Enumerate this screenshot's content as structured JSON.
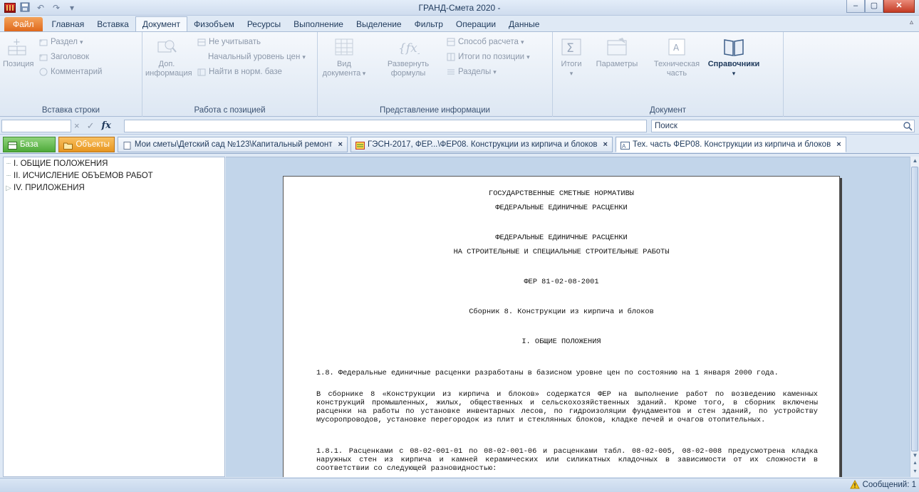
{
  "window": {
    "title": "ГРАНД-Смета 2020 -",
    "controls": [
      "minimize-button",
      "maximize-button",
      "close-button"
    ]
  },
  "quick_access": {
    "undo_label": "↶",
    "redo_label": "↷",
    "customize_label": "▾"
  },
  "ribbon_tabs": [
    "Файл",
    "Главная",
    "Вставка",
    "Документ",
    "Физобъем",
    "Ресурсы",
    "Выполнение",
    "Выделение",
    "Фильтр",
    "Операции",
    "Данные"
  ],
  "ribbon_active_tab": "Документ",
  "ribbon": {
    "insert_row": {
      "label": "Вставка строки",
      "position": "Позиция",
      "section": "Раздел",
      "heading": "Заголовок",
      "comment": "Комментарий"
    },
    "work_position": {
      "label": "Работа с позицией",
      "extra_info_1": "Доп.",
      "extra_info_2": "информация",
      "ignore": "Не учитывать",
      "price_level": "Начальный уровень цен",
      "find_base": "Найти в норм. базе"
    },
    "view_info": {
      "label": "Представление информации",
      "view_1": "Вид",
      "view_2": "документа",
      "expand_1": "Развернуть",
      "expand_2": "формулы",
      "calc_method": "Способ расчета",
      "totals_position": "Итоги по позиции",
      "sections": "Разделы"
    },
    "document": {
      "label": "Документ",
      "totals": "Итоги",
      "params": "Параметры",
      "tech_1": "Техническая",
      "tech_2": "часть",
      "reference": "Справочники"
    }
  },
  "formula_bar": {
    "cancel_icon": "×",
    "accept_icon": "✓",
    "fx_label": "fx",
    "search_placeholder": "Поиск"
  },
  "doc_tabs": {
    "base": "База",
    "objects": "Объекты",
    "estimate": "Мои сметы\\Детский сад №123\\Капитальный ремонт",
    "gesn": "ГЭСН-2017, ФЕР...\\ФЕР08. Конструкции из кирпича и блоков",
    "tech": "Тех. часть ФЕР08. Конструкции из кирпича и блоков",
    "close_glyph": "×"
  },
  "tree": [
    {
      "label": "I. ОБЩИЕ ПОЛОЖЕНИЯ",
      "connector": "┈"
    },
    {
      "label": "II. ИСЧИСЛЕНИЕ ОБЪЕМОВ РАБОТ",
      "connector": "┈"
    },
    {
      "label": "IV. ПРИЛОЖЕНИЯ",
      "connector": "▷"
    }
  ],
  "document": {
    "line1": "ГОСУДАРСТВЕННЫЕ СМЕТНЫЕ НОРМАТИВЫ",
    "line2": "ФЕДЕРАЛЬНЫЕ ЕДИНИЧНЫЕ РАСЦЕНКИ",
    "line3": "ФЕДЕРАЛЬНЫЕ ЕДИНИЧНЫЕ РАСЦЕНКИ",
    "line4": "НА СТРОИТЕЛЬНЫЕ И СПЕЦИАЛЬНЫЕ СТРОИТЕЛЬНЫЕ РАБОТЫ",
    "code": "ФЕР 81-02-08-2001",
    "collection": "Сборник 8. Конструкции из кирпича и блоков",
    "section": "I. ОБЩИЕ ПОЛОЖЕНИЯ",
    "p1": "1.8. Федеральные единичные расценки разработаны в базисном уровне цен по состоянию на 1 января 2000 года.",
    "p2": "В сборнике 8 «Конструкции из кирпича и блоков» содержатся ФЕР на выполнение работ по возведению каменных конструкций промышленных, жилых, общественных и сельскохозяйственных зданий. Кроме того, в сборник включены расценки на работы по установке инвентарных лесов, по гидроизоляции фундаментов и стен зданий, по устройству мусоропроводов, установке перегородок из плит и стеклянных блоков, кладке печей и очагов отопительных.",
    "p3": "1.8.1. Расценками с 08-02-001-01 по 08-02-001-06 и расценками табл. 08-02-005, 08-02-008 предусмотрена кладка наружных стен из кирпича и камней керамических или силикатных кладочных в зависимости от их сложности в соответствии со следующей разновидностью:"
  },
  "status": {
    "messages": "Сообщений: 1"
  },
  "colors": {
    "accent": "#2b579a",
    "file_tab": "#e0691c",
    "base_tab": "#4eaa3a",
    "objects_tab": "#e7951f"
  }
}
